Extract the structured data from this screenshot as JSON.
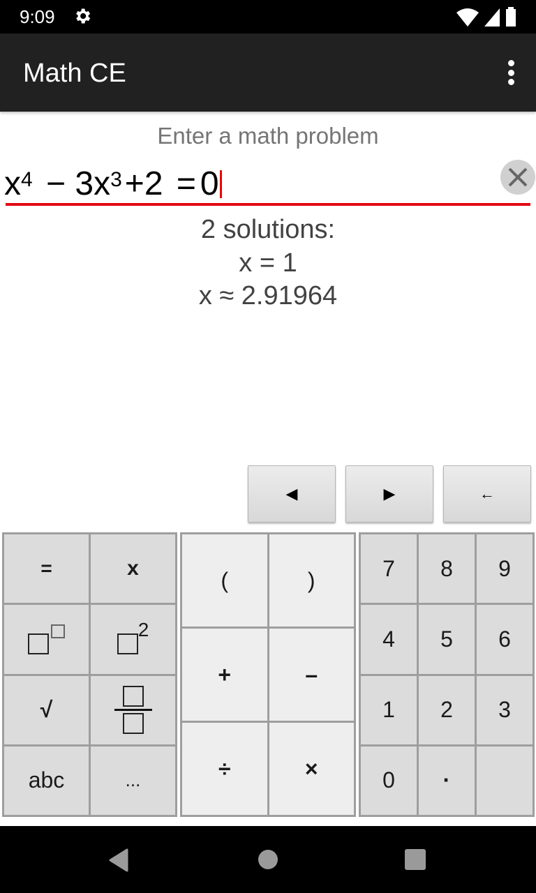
{
  "status_bar": {
    "time": "9:09",
    "icons": [
      "gear-icon",
      "wifi-icon",
      "signal-icon",
      "battery-icon"
    ]
  },
  "app_bar": {
    "title": "Math CE",
    "menu_icon": "more-vert-icon"
  },
  "input": {
    "hint": "Enter a math problem",
    "expression": {
      "base1": "x",
      "exp1": "4",
      "op1": "−",
      "coef": "3",
      "base2": "x",
      "exp2": "3",
      "op2": "+",
      "const": "2",
      "eq": "=",
      "rhs": "0"
    },
    "clear_icon": "close-icon",
    "accent_color": "#e30613"
  },
  "result": {
    "header": "2 solutions:",
    "solutions": [
      "x = 1",
      "x ≈ 2.91964"
    ]
  },
  "nav_keys": [
    {
      "label": "◀",
      "name": "cursor-left-button"
    },
    {
      "label": "▶",
      "name": "cursor-right-button"
    },
    {
      "label": "←",
      "name": "backspace-button"
    }
  ],
  "keypad": {
    "left": [
      "=",
      "x",
      "□^□",
      "□²",
      "√",
      "□/□",
      "abc",
      "..."
    ],
    "middle": [
      "(",
      ")",
      "+",
      "–",
      "÷",
      "×"
    ],
    "right": [
      "7",
      "8",
      "9",
      "4",
      "5",
      "6",
      "1",
      "2",
      "3",
      "0",
      "·",
      ""
    ]
  },
  "nav_bar": {
    "icons": [
      "back-icon",
      "home-icon",
      "recents-icon"
    ]
  }
}
